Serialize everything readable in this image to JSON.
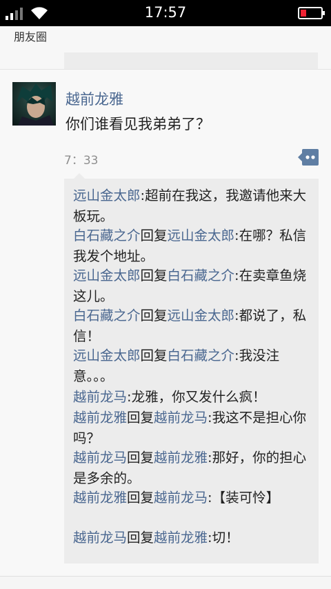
{
  "status_bar": {
    "time": "17:57"
  },
  "nav": {
    "title": "朋友圈"
  },
  "post": {
    "author": "越前龙雅",
    "content": "你们谁看见我弟弟了？",
    "time": "7：33"
  },
  "comments": [
    {
      "author": "远山金太郎",
      "reply_word": "",
      "reply_to": "",
      "text": ":超前在我这，我邀请他来大板玩。"
    },
    {
      "author": "白石藏之介",
      "reply_word": "回复",
      "reply_to": "远山金太郎",
      "text": ":在哪？私信我发个地址。"
    },
    {
      "author": "远山金太郎",
      "reply_word": "回复",
      "reply_to": "白石藏之介",
      "text": ":在卖章鱼烧这儿。"
    },
    {
      "author": "白石藏之介",
      "reply_word": "回复",
      "reply_to": "远山金太郎",
      "text": ":都说了，私信！"
    },
    {
      "author": "远山金太郎",
      "reply_word": "回复",
      "reply_to": "白石藏之介",
      "text": ":我没注意。。。"
    },
    {
      "author": "越前龙马",
      "reply_word": "",
      "reply_to": "",
      "text": ":龙雅，你又发什么疯！"
    },
    {
      "author": "越前龙雅",
      "reply_word": "回复",
      "reply_to": "越前龙马",
      "text": ":我这不是担心你吗？"
    },
    {
      "author": "越前龙马",
      "reply_word": "回复",
      "reply_to": "越前龙雅",
      "text": ":那好，你的担心是多余的。"
    },
    {
      "author": "越前龙雅",
      "reply_word": "回复",
      "reply_to": "越前龙马",
      "text": ":【装可怜】"
    },
    {
      "author": "越前龙马",
      "reply_word": "回复",
      "reply_to": "越前龙雅",
      "text": ":切！"
    }
  ]
}
